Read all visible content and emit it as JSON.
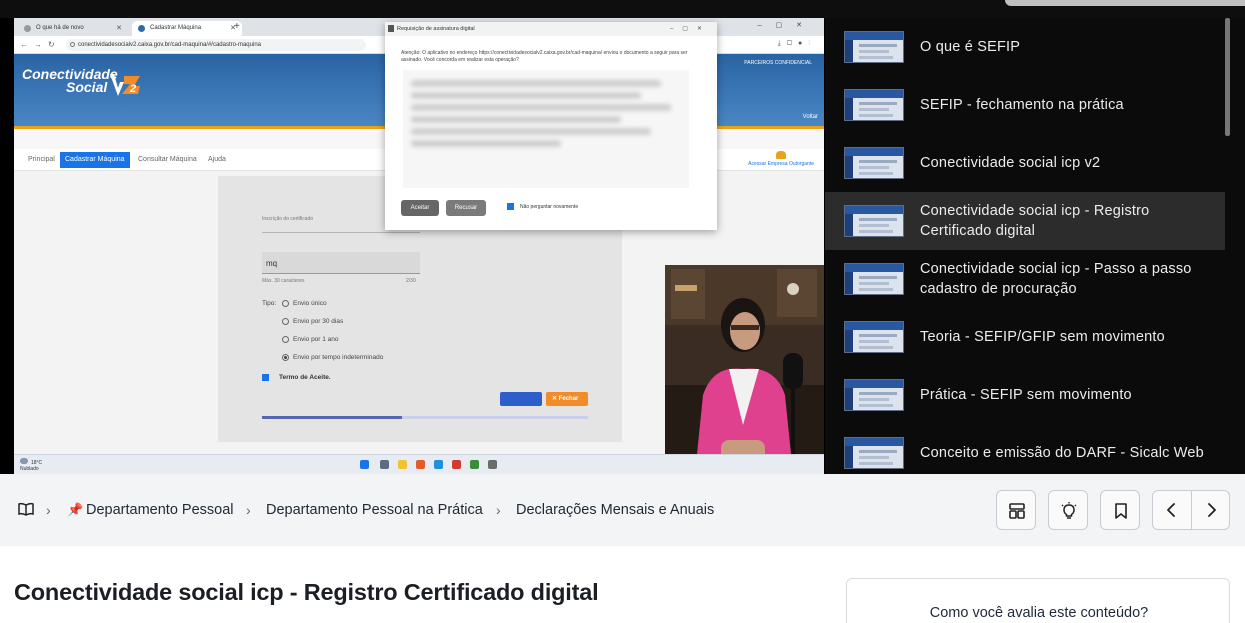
{
  "video": {
    "browser": {
      "tabs": [
        {
          "label": "O que há de novo"
        },
        {
          "label": "Cadastrar Máquina"
        }
      ],
      "url": "conectividadesocialv2.caixa.gov.br/cad-maquina/#/cadastro-maquina"
    },
    "site": {
      "logo_line1": "Conectividade",
      "logo_line2": "Social",
      "header_right": "PARCEIROS CONFIDENCIAL",
      "voltar": "Voltar",
      "nav": [
        {
          "label": "Principal"
        },
        {
          "label": "Cadastrar Máquina"
        },
        {
          "label": "Consultar Máquina"
        },
        {
          "label": "Ajuda"
        }
      ],
      "user_label": "Acessar Empresa Outorgante"
    },
    "form": {
      "cert_label": "Inscrição do certificado",
      "name_value": "mq",
      "hint": "Máx. 30 caracteres",
      "counter": "2/30",
      "tipo_label": "Tipo:",
      "radios": [
        {
          "label": "Envio único",
          "selected": false
        },
        {
          "label": "Envio por 30 dias",
          "selected": false
        },
        {
          "label": "Envio por 1 ano",
          "selected": false
        },
        {
          "label": "Envio por tempo indeterminado",
          "selected": true
        }
      ],
      "termo": "Termo de Aceite.",
      "close_label": "✕ Fechar",
      "progress": 0.43
    },
    "dialog": {
      "title": "Requisição de assinatura digital",
      "message": "Atenção: O aplicativo no endereço https://conectividadesocialv2.caixa.gov.br/cad-maquina/ enviou o documento a seguir para ser assinado. Você concorda em realizar esta operação?",
      "accept": "Aceitar",
      "refuse": "Recusar",
      "dont_ask": "Não perguntar novamente",
      "dont_ask_checked": true
    },
    "taskbar": {
      "temp": "18°C",
      "weather": "Nublado"
    }
  },
  "playlist": {
    "items": [
      {
        "title": "O que é SEFIP",
        "active": false
      },
      {
        "title": "SEFIP - fechamento na prática",
        "active": false
      },
      {
        "title": "Conectividade social icp v2",
        "active": false
      },
      {
        "title": "Conectividade social icp - Registro Certificado digital",
        "active": true
      },
      {
        "title": "Conectividade social icp - Passo a passo cadastro de procuração",
        "active": false
      },
      {
        "title": "Teoria - SEFIP/GFIP sem movimento",
        "active": false
      },
      {
        "title": "Prática - SEFIP sem movimento",
        "active": false
      },
      {
        "title": "Conceito e emissão do DARF - Sicalc Web",
        "active": false
      }
    ]
  },
  "breadcrumb": {
    "items": [
      {
        "label": "Departamento Pessoal",
        "pinned": true
      },
      {
        "label": "Departamento Pessoal na Prática"
      },
      {
        "label": "Declarações Mensais e Anuais"
      }
    ]
  },
  "toolbar": {
    "icons": [
      "layout-icon",
      "lightbulb-icon",
      "bookmark-icon",
      "chevron-left-icon",
      "chevron-right-icon"
    ]
  },
  "lesson": {
    "title": "Conectividade social icp - Registro Certificado digital"
  },
  "rating": {
    "question": "Como você avalia este conteúdo?"
  },
  "colors": {
    "accent_blue": "#1a73e8",
    "caixa_orange": "#f28c28",
    "playlist_bg": "#0b0b0b",
    "active_item_bg": "#2c2c2c"
  }
}
